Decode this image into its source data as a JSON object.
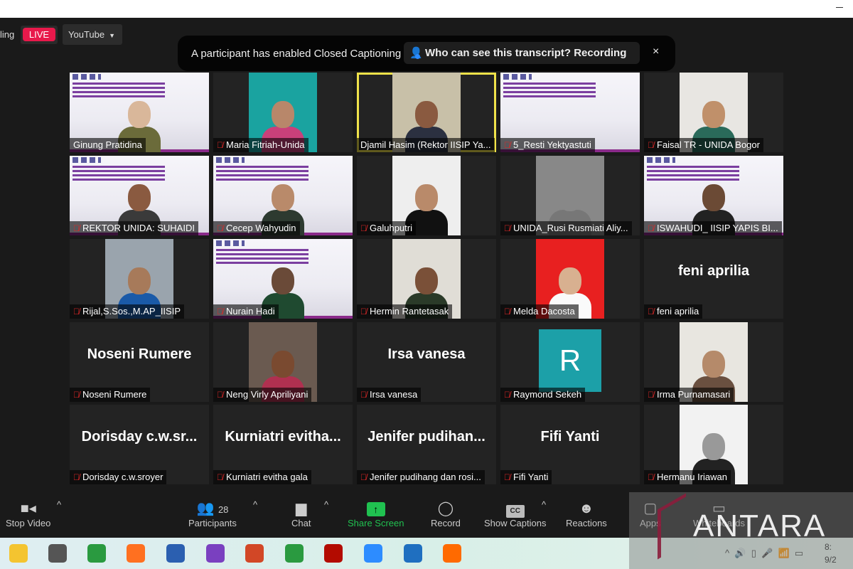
{
  "stream": {
    "status_text": "ling",
    "live_label": "LIVE",
    "platform": "YouTube"
  },
  "banner": {
    "message": "A participant has enabled Closed Captioning",
    "pill": "Who can see this transcript? Recording on",
    "close": "×"
  },
  "tiles": [
    {
      "name": "Ginung Pratidina",
      "type": "slide",
      "muted": false,
      "skin": "#d9b79a",
      "shirt": "#6b6b3a"
    },
    {
      "name": "Maria Fitriah-Unida",
      "type": "video",
      "muted": true,
      "bg": "#1aa3a0",
      "skin": "#b8876a",
      "shirt": "#c9407a"
    },
    {
      "name": "Djamil Hasim (Rektor IISIP Ya...",
      "type": "video",
      "muted": false,
      "active": true,
      "bg": "#c8c0a8",
      "skin": "#8a5a40",
      "shirt": "#2b3040"
    },
    {
      "name": "5_Resti Yektyastuti",
      "type": "slide",
      "muted": true
    },
    {
      "name": "Faisal TR - UNIDA Bogor",
      "type": "video",
      "muted": true,
      "bg": "#e8e6e2",
      "skin": "#c0906a",
      "shirt": "#2a6a5a"
    },
    {
      "name": "REKTOR UNIDA: SUHAIDI",
      "type": "slide",
      "muted": true,
      "skin": "#8a5a40",
      "shirt": "#3a3a3a"
    },
    {
      "name": "Cecep Wahyudin",
      "type": "slide",
      "muted": true,
      "skin": "#b98a6a",
      "shirt": "#2d3a30"
    },
    {
      "name": "Galuhputri",
      "type": "video",
      "muted": true,
      "bg": "#eee",
      "skin": "#b98a6a",
      "shirt": "#111"
    },
    {
      "name": "UNIDA_Rusi Rusmiati Aliy...",
      "type": "video",
      "muted": true,
      "bg": "#888",
      "skin": "#888",
      "shirt": "#777"
    },
    {
      "name": "ISWAHUDI_ IISIP YAPIS BI...",
      "type": "slide",
      "muted": true,
      "skin": "#6b4a35",
      "shirt": "#222"
    },
    {
      "name": "Rijal,S.Sos.,M.AP_IISIP",
      "type": "video",
      "muted": true,
      "bg": "#9aa4ad",
      "skin": "#a77a5a",
      "shirt": "#1a5aa8"
    },
    {
      "name": "Nurain Hadi",
      "type": "slide",
      "muted": true,
      "skin": "#6a4a38",
      "shirt": "#1f4a30"
    },
    {
      "name": "Hermin Rantetasak",
      "type": "video",
      "muted": true,
      "bg": "#e0ddd6",
      "skin": "#7a5038",
      "shirt": "#2a3a28"
    },
    {
      "name": "Melda Dacosta",
      "type": "video",
      "muted": true,
      "bg": "#e82020",
      "skin": "#d8b090",
      "shirt": "#fafafa"
    },
    {
      "name": "feni aprilia",
      "type": "text",
      "display": "feni aprilia",
      "muted": true
    },
    {
      "name": "Noseni  Rumere",
      "type": "text",
      "display": "Noseni  Rumere",
      "muted": true
    },
    {
      "name": "Neng Virly Apriliyani",
      "type": "video",
      "muted": true,
      "bg": "#6a5a50",
      "skin": "#7a4a30",
      "shirt": "#b03050"
    },
    {
      "name": "Irsa vanesa",
      "type": "text",
      "display": "Irsa vanesa",
      "muted": true
    },
    {
      "name": "Raymond Sekeh",
      "type": "avatar",
      "letter": "R",
      "muted": true
    },
    {
      "name": "Irma Purnamasari",
      "type": "video",
      "muted": true,
      "bg": "#e8e6e0",
      "skin": "#b58a6a",
      "shirt": "#6a5040"
    },
    {
      "name": "Dorisday c.w.sroyer",
      "type": "text",
      "display": "Dorisday  c.w.sr...",
      "muted": true
    },
    {
      "name": "Kurniatri evitha gala",
      "type": "text",
      "display": "Kurniatri  evitha...",
      "muted": true
    },
    {
      "name": "Jenifer pudihang dan rosi...",
      "type": "text",
      "display": "Jenifer  pudihan...",
      "muted": true
    },
    {
      "name": "Fifi Yanti",
      "type": "text",
      "display": "Fifi Yanti",
      "muted": true
    },
    {
      "name": "Hermanu Iriawan",
      "type": "video",
      "muted": true,
      "bg": "#f2f2f2",
      "skin": "#999",
      "shirt": "#222"
    }
  ],
  "toolbar": {
    "stop_video": "Stop Video",
    "participants": "Participants",
    "participants_count": "28",
    "chat": "Chat",
    "share_screen": "Share Screen",
    "record": "Record",
    "show_captions": "Show Captions",
    "cc": "CC",
    "reactions": "Reactions",
    "apps": "Apps",
    "whiteboards": "Whiteboards"
  },
  "watermark": "ANTARA",
  "taskbar": {
    "apps": [
      "file-explorer",
      "camera",
      "chrome",
      "firefox",
      "word",
      "vpn",
      "powerpoint",
      "chrome-profile",
      "acrobat",
      "zoom",
      "photos",
      "app"
    ],
    "colors": [
      "#f4c430",
      "#555",
      "#2a9a40",
      "#ff7020",
      "#2b5fb0",
      "#7a40c0",
      "#d24726",
      "#2a9a40",
      "#b30b00",
      "#2d8cff",
      "#1f6fc0",
      "#ff6a00"
    ],
    "clock_time": "8:",
    "clock_date": "9/2"
  },
  "colors": {
    "live": "#e8194b",
    "share": "#20c150",
    "active_speaker": "#f0e24a",
    "muted": "#e02828"
  }
}
